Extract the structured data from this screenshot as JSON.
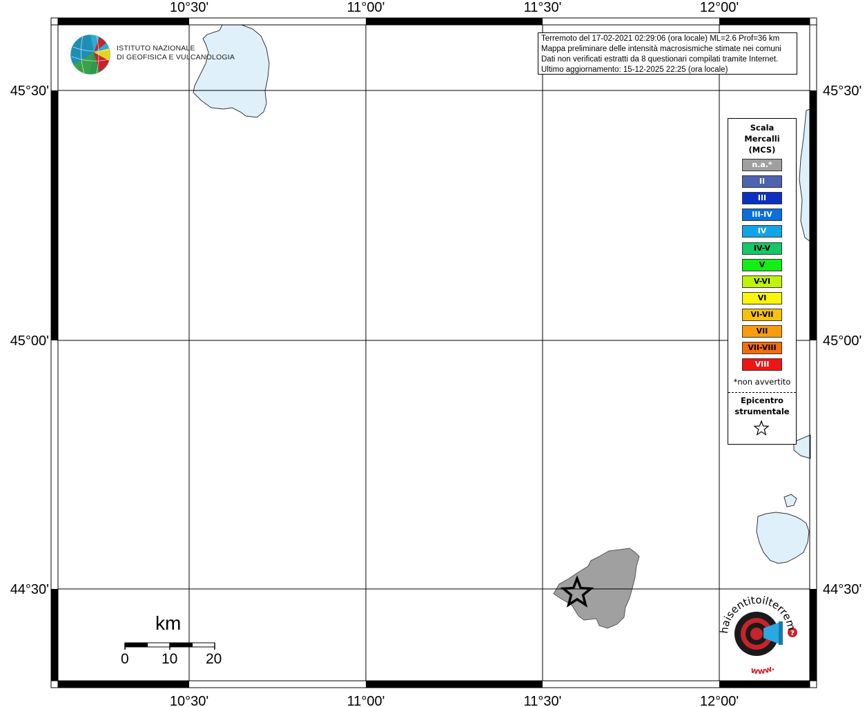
{
  "map": {
    "longitude_labels": [
      "10°30'",
      "11°00'",
      "11°30'",
      "12°00'"
    ],
    "latitude_labels": [
      "45°30'",
      "45°00'",
      "44°30'"
    ]
  },
  "info": {
    "line1": "Terremoto del 17-02-2021 02:29:06 (ora locale) ML=2.6 Prof=36 km",
    "line2": "Mappa preliminare delle intensità macrosismiche stimate nei comuni",
    "line3": "Dati non verificati estratti da 8 questionari compilati tramite Internet.",
    "line4": "Ultimo aggiornamento: 15-12-2025 22:25 (ora locale)"
  },
  "ingv": {
    "line1": "ISTITUTO NAZIONALE",
    "line2": "DI GEOFISICA E VULCANOLOGIA"
  },
  "legend": {
    "title1": "Scala",
    "title2": "Mercalli",
    "title3": "(MCS)",
    "items": [
      {
        "label": "n.a.*",
        "color": "#a0a0a0",
        "text_color": "#ffffff"
      },
      {
        "label": "II",
        "color": "#4d62b0",
        "text_color": "#ffffff"
      },
      {
        "label": "III",
        "color": "#0b31c3",
        "text_color": "#ffffff"
      },
      {
        "label": "III-IV",
        "color": "#0a6fdc",
        "text_color": "#ffffff"
      },
      {
        "label": "IV",
        "color": "#12a4e8",
        "text_color": "#ffffff"
      },
      {
        "label": "IV-V",
        "color": "#16c765",
        "text_color": "#000000"
      },
      {
        "label": "V",
        "color": "#13ef13",
        "text_color": "#000000"
      },
      {
        "label": "V-VI",
        "color": "#bff20c",
        "text_color": "#000000"
      },
      {
        "label": "VI",
        "color": "#f8f40a",
        "text_color": "#000000"
      },
      {
        "label": "VI-VII",
        "color": "#f6c20c",
        "text_color": "#000000"
      },
      {
        "label": "VII",
        "color": "#f99d0e",
        "text_color": "#000000"
      },
      {
        "label": "VII-VIII",
        "color": "#f46c0c",
        "text_color": "#000000"
      },
      {
        "label": "VIII",
        "color": "#f01414",
        "text_color": "#ffffff"
      }
    ],
    "note": "*non avvertito",
    "epicentro1": "Epicentro",
    "epicentro2": "strumentale"
  },
  "scale": {
    "unit": "km",
    "labels": [
      "0",
      "10",
      "20"
    ]
  },
  "hst": {
    "text": "haisentitoilterremoto.it",
    "www": "www."
  },
  "colors": {
    "water": "#e0f0fa",
    "felt_area": "#a0a0a0",
    "frame": "#000000"
  }
}
